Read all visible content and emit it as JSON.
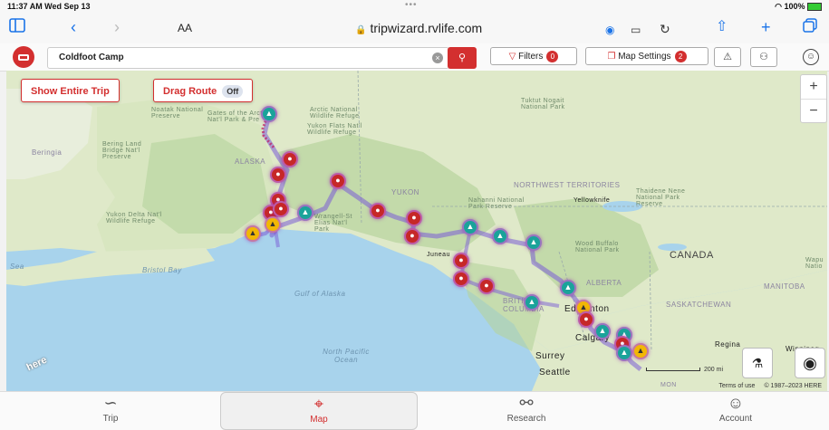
{
  "status_bar": {
    "time": "11:37 AM  Wed Sep 13",
    "dots": "•••",
    "battery": "100%"
  },
  "browser": {
    "text_size": "AA",
    "url": "tripwizard.rvlife.com"
  },
  "toolbar": {
    "search_value": "Coldfoot Camp",
    "filters_label": "Filters",
    "filters_count": "0",
    "map_settings_label": "Map Settings",
    "map_settings_count": "2"
  },
  "map": {
    "show_entire_trip": "Show Entire Trip",
    "drag_route_label": "Drag Route",
    "drag_route_state": "Off",
    "zoom_in": "+",
    "zoom_out": "−",
    "scale_label": "200 mi",
    "terms": "Terms of use",
    "copyright": "© 1987–2023 HERE",
    "labels": {
      "noatak": "Noatak National Preserve",
      "gates": "Gates of the Arctic Nat'l Park & Pre",
      "anwr": "Arctic National Wildlife Refuge",
      "yukon_flats": "Yukon Flats Nat'l Wildlife Refuge",
      "bering": "Bering Land Bridge Nat'l Preserve",
      "beringia": "Beringia",
      "alaska": "ALASKA",
      "yukon": "YUKON",
      "tuktut": "Tuktut Nogait National Park",
      "nwt": "NORTHWEST TERRITORIES",
      "nahanni": "Nahanni National Park Reserve",
      "yellowknife": "Yellowknife",
      "thaidene": "Thaidene Nene National Park Reserve",
      "yukon_delta": "Yukon Delta Nat'l Wildlife Refuge",
      "wrangell": "Wrangell-St Elias Nat'l Park",
      "wood_buffalo": "Wood Buffalo National Park",
      "canada": "CANADA",
      "wapusk": "Wapu Natio",
      "bristol": "Bristol Bay",
      "gulf": "Gulf of Alaska",
      "juneau": "Juneau",
      "alberta": "ALBERTA",
      "bc": "BRITISH COLUMBIA",
      "edmonton": "Edmonton",
      "sask": "SASKATCHEWAN",
      "manitoba": "MANITOBA",
      "calgary": "Calgary",
      "regina": "Regina",
      "winnipeg": "Winnipeg",
      "north_pacific": "North Pacific Ocean",
      "surrey": "Surrey",
      "seattle": "Seattle",
      "sea": "Sea",
      "mon": "MON"
    }
  },
  "nav": {
    "trip": "Trip",
    "map": "Map",
    "research": "Research",
    "account": "Account"
  },
  "colors": {
    "accent": "#d32f2f",
    "route": "#7a5cd6",
    "campground": "#1aa39a",
    "marker": "#c62828",
    "warning": "#f2b705"
  }
}
